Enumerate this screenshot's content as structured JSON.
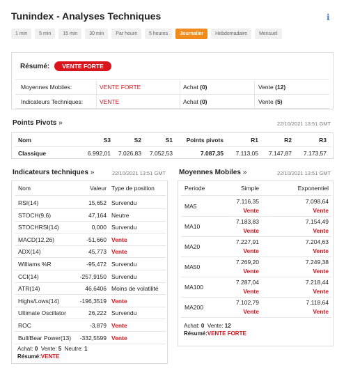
{
  "title": "Tunindex - Analyses Techniques",
  "info_icon": "info-icon",
  "tabs": [
    "1 min",
    "5 min",
    "15 min",
    "30 min",
    "Par heure",
    "5 heures",
    "Journalier",
    "Hebdomadaire",
    "Mensuel"
  ],
  "active_tab": "Journalier",
  "resume": {
    "label": "Résumé:",
    "badge": "VENTE FORTE",
    "rows": [
      {
        "name": "Moyennes Mobiles:",
        "signal": "VENTE FORTE",
        "achat_label": "Achat",
        "achat": "(0)",
        "vente_label": "Vente",
        "vente": "(12)"
      },
      {
        "name": "Indicateurs Techniques:",
        "signal": "VENTE",
        "achat_label": "Achat",
        "achat": "(0)",
        "vente_label": "Vente",
        "vente": "(5)"
      }
    ]
  },
  "pivots": {
    "title": "Points Pivots",
    "arrow": "»",
    "timestamp": "22/10/2021 13:51 GMT",
    "headers": [
      "Nom",
      "S3",
      "S2",
      "S1",
      "Points pivots",
      "R1",
      "R2",
      "R3"
    ],
    "row": [
      "Classique",
      "6.992,01",
      "7.026,83",
      "7.052,53",
      "7.087,35",
      "7.113,05",
      "7.147,87",
      "7.173,57"
    ]
  },
  "indicators": {
    "title": "Indicateurs techniques",
    "arrow": "»",
    "timestamp": "22/10/2021 13:51 GMT",
    "headers": [
      "Nom",
      "Valeur",
      "Type de position"
    ],
    "rows": [
      {
        "name": "RSI(14)",
        "value": "15,652",
        "position": "Survendu",
        "red": false
      },
      {
        "name": "STOCH(9,6)",
        "value": "47,164",
        "position": "Neutre",
        "red": false
      },
      {
        "name": "STOCHRSI(14)",
        "value": "0,000",
        "position": "Survendu",
        "red": false
      },
      {
        "name": "MACD(12,26)",
        "value": "-51,660",
        "position": "Vente",
        "red": true
      },
      {
        "name": "ADX(14)",
        "value": "45,773",
        "position": "Vente",
        "red": true
      },
      {
        "name": "Williams %R",
        "value": "-95,472",
        "position": "Survendu",
        "red": false
      },
      {
        "name": "CCI(14)",
        "value": "-257,9150",
        "position": "Survendu",
        "red": false
      },
      {
        "name": "ATR(14)",
        "value": "46,6406",
        "position": "Moins de volatilité",
        "red": false
      },
      {
        "name": "Highs/Lows(14)",
        "value": "-196,3519",
        "position": "Vente",
        "red": true
      },
      {
        "name": "Ultimate Oscillator",
        "value": "26,222",
        "position": "Survendu",
        "red": false
      },
      {
        "name": "ROC",
        "value": "-3,879",
        "position": "Vente",
        "red": true
      },
      {
        "name": "Bull/Bear Power(13)",
        "value": "-332,5599",
        "position": "Vente",
        "red": true
      }
    ],
    "summary": {
      "achat_label": "Achat:",
      "achat": "0",
      "vente_label": "Vente:",
      "vente": "5",
      "neutre_label": "Neutre:",
      "neutre": "1",
      "resume_label": "Résumé:",
      "resume": "VENTE"
    }
  },
  "moving_averages": {
    "title": "Moyennes Mobiles",
    "arrow": "»",
    "timestamp": "22/10/2021 13:51 GMT",
    "headers": [
      "Periode",
      "Simple",
      "Exponentiel"
    ],
    "rows": [
      {
        "period": "MA5",
        "simple": "7.116,35",
        "simple_signal": "Vente",
        "exp": "7.098,64",
        "exp_signal": "Vente"
      },
      {
        "period": "MA10",
        "simple": "7.183,83",
        "simple_signal": "Vente",
        "exp": "7.154,49",
        "exp_signal": "Vente"
      },
      {
        "period": "MA20",
        "simple": "7.227,91",
        "simple_signal": "Vente",
        "exp": "7.204,63",
        "exp_signal": "Vente"
      },
      {
        "period": "MA50",
        "simple": "7.269,20",
        "simple_signal": "Vente",
        "exp": "7.249,38",
        "exp_signal": "Vente"
      },
      {
        "period": "MA100",
        "simple": "7.287,04",
        "simple_signal": "Vente",
        "exp": "7.218,44",
        "exp_signal": "Vente"
      },
      {
        "period": "MA200",
        "simple": "7.102,79",
        "simple_signal": "Vente",
        "exp": "7.118,64",
        "exp_signal": "Vente"
      }
    ],
    "summary": {
      "achat_label": "Achat:",
      "achat": "0",
      "vente_label": "Vente:",
      "vente": "12",
      "resume_label": "Résumé:",
      "resume": "VENTE FORTE"
    }
  }
}
